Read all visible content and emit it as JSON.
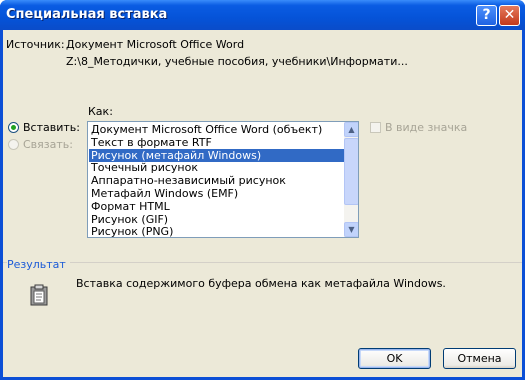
{
  "window": {
    "title": "Специальная вставка",
    "help_label": "?",
    "close_label": "✕"
  },
  "source": {
    "label": "Источник:",
    "line1": "Документ Microsoft Office Word",
    "line2": "Z:\\8_Методички, учебные пособия, учебники\\Информати..."
  },
  "options": {
    "how_label": "Как:",
    "paste_label": "Вставить:",
    "paste_selected": true,
    "link_label": "Связать:",
    "link_enabled": false
  },
  "list": {
    "items": [
      "Документ Microsoft Office Word (объект)",
      "Текст в формате RTF",
      "Рисунок (метафайл Windows)",
      "Точечный рисунок",
      "Аппаратно-независимый рисунок",
      "Метафайл Windows (EMF)",
      "Формат HTML",
      "Рисунок (GIF)",
      "Рисунок (PNG)"
    ],
    "selected_index": 2
  },
  "display_as_icon": {
    "label": "В виде значка",
    "checked": false,
    "enabled": false
  },
  "result": {
    "label": "Результат",
    "text": "Вставка содержимого буфера обмена как метафайла Windows.",
    "icon": "clipboard-icon"
  },
  "buttons": {
    "ok": "OK",
    "cancel": "Отмена"
  },
  "colors": {
    "title_bar": "#0553d8",
    "selection": "#316ac5",
    "result_label": "#1c5bd7"
  }
}
